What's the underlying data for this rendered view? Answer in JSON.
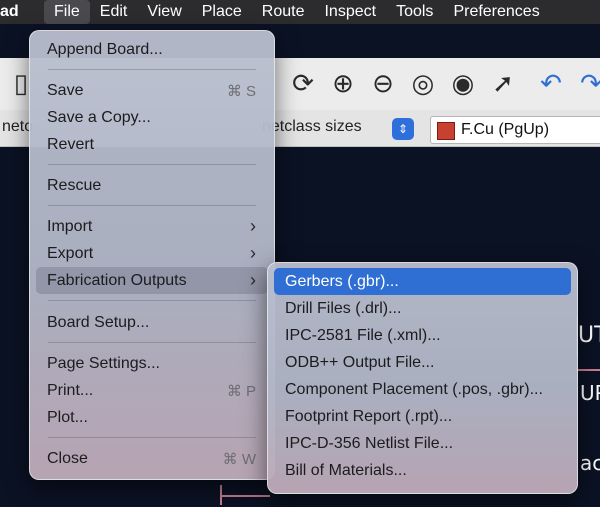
{
  "menubar": {
    "app": "ad",
    "items": [
      "File",
      "Edit",
      "View",
      "Place",
      "Route",
      "Inspect",
      "Tools",
      "Preferences"
    ]
  },
  "toolbar2": {
    "left_text": "neto",
    "netclass_text": "netclass sizes",
    "layer": "F.Cu (PgUp)",
    "layer_color": "#c8402f"
  },
  "file_menu": {
    "append_board": "Append Board...",
    "save": "Save",
    "save_sc": "⌘ S",
    "save_copy": "Save a Copy...",
    "revert": "Revert",
    "rescue": "Rescue",
    "import": "Import",
    "export": "Export",
    "fab_outputs": "Fabrication Outputs",
    "board_setup": "Board Setup...",
    "page_settings": "Page Settings...",
    "print": "Print...",
    "print_sc": "⌘ P",
    "plot": "Plot...",
    "close": "Close",
    "close_sc": "⌘ W"
  },
  "fab_submenu": {
    "items": [
      "Gerbers (.gbr)...",
      "Drill Files (.drl)...",
      "IPC-2581 File (.xml)...",
      "ODB++ Output File...",
      "Component Placement (.pos, .gbr)...",
      "Footprint Report (.rpt)...",
      "IPC-D-356 Netlist File...",
      "Bill of Materials..."
    ]
  },
  "canvas": {
    "text_right_1": "UT",
    "text_right_2": "UP",
    "text_right_3": "ac"
  }
}
